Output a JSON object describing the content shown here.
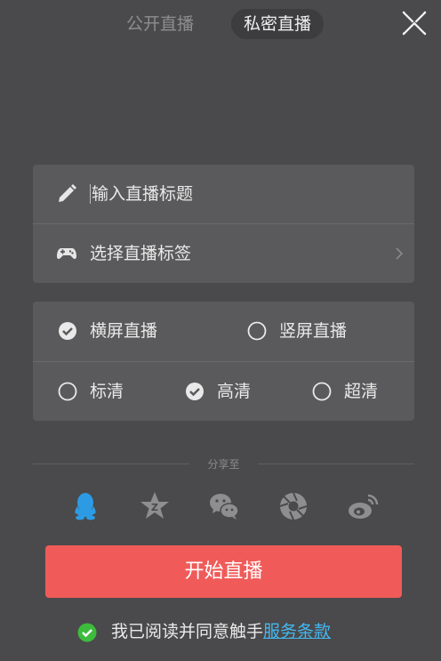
{
  "tabs": {
    "public": "公开直播",
    "private": "私密直播"
  },
  "form": {
    "title_placeholder": "输入直播标题",
    "tag_label": "选择直播标签"
  },
  "orientation": {
    "landscape": "横屏直播",
    "portrait": "竖屏直播",
    "selected": "landscape"
  },
  "quality": {
    "standard": "标清",
    "high": "高清",
    "ultra": "超清",
    "selected": "high"
  },
  "share": {
    "title": "分享至",
    "icons": [
      "qq-icon",
      "qzone-icon",
      "wechat-icon",
      "moments-icon",
      "weibo-icon"
    ],
    "active": "qq-icon"
  },
  "start_label": "开始直播",
  "agreement": {
    "prefix": "我已阅读并同意触手",
    "link": "服务条款"
  },
  "colors": {
    "accent": "#f05b59",
    "link": "#43b8f0",
    "check_green": "#3dbb3d",
    "qq_blue": "#2d9be4"
  }
}
